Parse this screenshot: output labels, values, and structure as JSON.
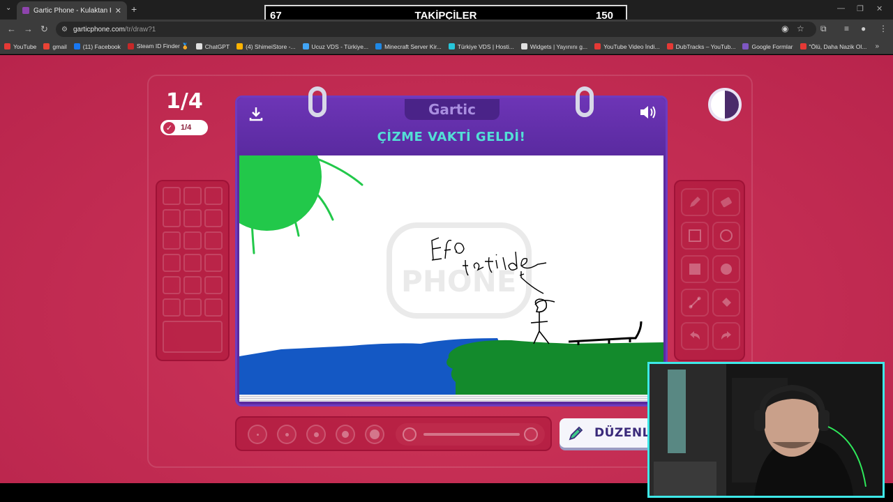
{
  "browser": {
    "tab_title": "Gartic Phone - Kulaktan Kulağa",
    "url_host": "garticphone.com",
    "url_path": "/tr/draw?1",
    "bookmarks": [
      {
        "label": "YouTube",
        "color": "#e53935"
      },
      {
        "label": "gmail",
        "color": "#ea4335"
      },
      {
        "label": "(11) Facebook",
        "color": "#1877f2"
      },
      {
        "label": "Steam ID Finder 🏅",
        "color": "#c62828"
      },
      {
        "label": "ChatGPT",
        "color": "#e0e0e0"
      },
      {
        "label": "(4) ShimeiStore -...",
        "color": "#ffb300"
      },
      {
        "label": "Ucuz VDS - Türkiye...",
        "color": "#42a5f5"
      },
      {
        "label": "Minecraft Server Kir...",
        "color": "#1e88e5"
      },
      {
        "label": "Türkiye VDS | Hosti...",
        "color": "#26c6da"
      },
      {
        "label": "Widgets | Yayınını g...",
        "color": "#e0e0e0"
      },
      {
        "label": "YouTube Video İndi...",
        "color": "#e53935"
      },
      {
        "label": "DubTracks – YouTub...",
        "color": "#e53935"
      },
      {
        "label": "Google Formlar",
        "color": "#7e57c2"
      },
      {
        "label": "\"Ölü, Daha Nazik Ol...",
        "color": "#e53935"
      }
    ]
  },
  "followers": {
    "current": "67",
    "label": "TAKİPÇİLER",
    "goal": "150"
  },
  "game": {
    "round": "1/4",
    "submitted": "1/4",
    "logo": "Gartic",
    "title": "ÇİZME VAKTİ GELDİ!",
    "edit_button": "DÜZENLE",
    "watermark": "PHONE",
    "drawing_text_1": "Efo",
    "drawing_text_2": "tatilde"
  },
  "colors": {
    "page_bg": "#c52e54",
    "card_purple": "#5b2a9e",
    "title_teal": "#53e0d6",
    "sun_green": "#22c84a",
    "sea_blue": "#1458c4",
    "grass_green": "#138a2c",
    "webcam_border": "#3ee8e8"
  },
  "icons": {
    "download": "download-icon",
    "volume": "volume-icon",
    "timer": "timer-icon",
    "check": "check-icon",
    "pencil": "pencil-icon"
  },
  "tools": [
    "pencil",
    "eraser",
    "rectangle",
    "ellipse",
    "filled-rectangle",
    "filled-ellipse",
    "line",
    "bucket",
    "undo",
    "redo"
  ]
}
